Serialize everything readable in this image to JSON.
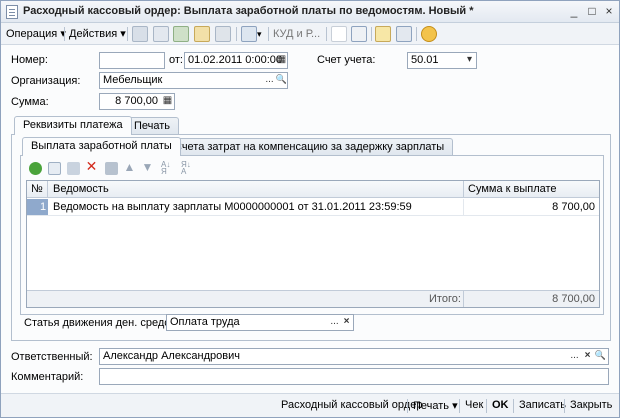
{
  "window": {
    "title": "Расходный кассовый ордер: Выплата заработной платы по ведомостям. Новый *",
    "controls": [
      "_",
      "□",
      "×"
    ]
  },
  "toolbar": {
    "operation_label": "Операция",
    "actions_label": "Действия",
    "kud_label": "КУД и Р...",
    "dropdown_arrow": "▾"
  },
  "form": {
    "number_label": "Номер:",
    "number_value": "",
    "from_label": "от:",
    "date_value": "01.02.2011  0:00:00",
    "account_label": "Счет учета:",
    "account_value": "50.01",
    "org_label": "Организация:",
    "org_value": "Мебельщик",
    "sum_label": "Сумма:",
    "sum_value": "8 700,00"
  },
  "tabs": {
    "outer": [
      "Реквизиты платежа",
      "Печать"
    ],
    "inner": [
      "Выплата заработной платы",
      "Счета затрат на компенсацию за задержку зарплаты"
    ]
  },
  "table": {
    "headers": [
      "№",
      "Ведомость",
      "Сумма к выплате"
    ],
    "rows": [
      {
        "n": "1",
        "statement": "Ведомость на выплату зарплаты М0000000001 от 31.01.2011 23:59:59",
        "amount": "8 700,00"
      }
    ],
    "total_label": "Итого:",
    "total_value": "8 700,00"
  },
  "cashflow": {
    "label": "Статья движения ден. средств:",
    "value": "Оплата труда"
  },
  "responsible": {
    "label": "Ответственный:",
    "value": "Александр Александрович"
  },
  "comment": {
    "label": "Комментарий:",
    "value": ""
  },
  "footer": {
    "print_form": "Расходный кассовый ордер",
    "print": "Печать",
    "check": "Чек",
    "ok": "OK",
    "save": "Записать",
    "close": "Закрыть"
  },
  "glyphs": {
    "ellipsis": "...",
    "search": "🔍",
    "clear": "×",
    "select": "▾",
    "calendar": "▦"
  }
}
